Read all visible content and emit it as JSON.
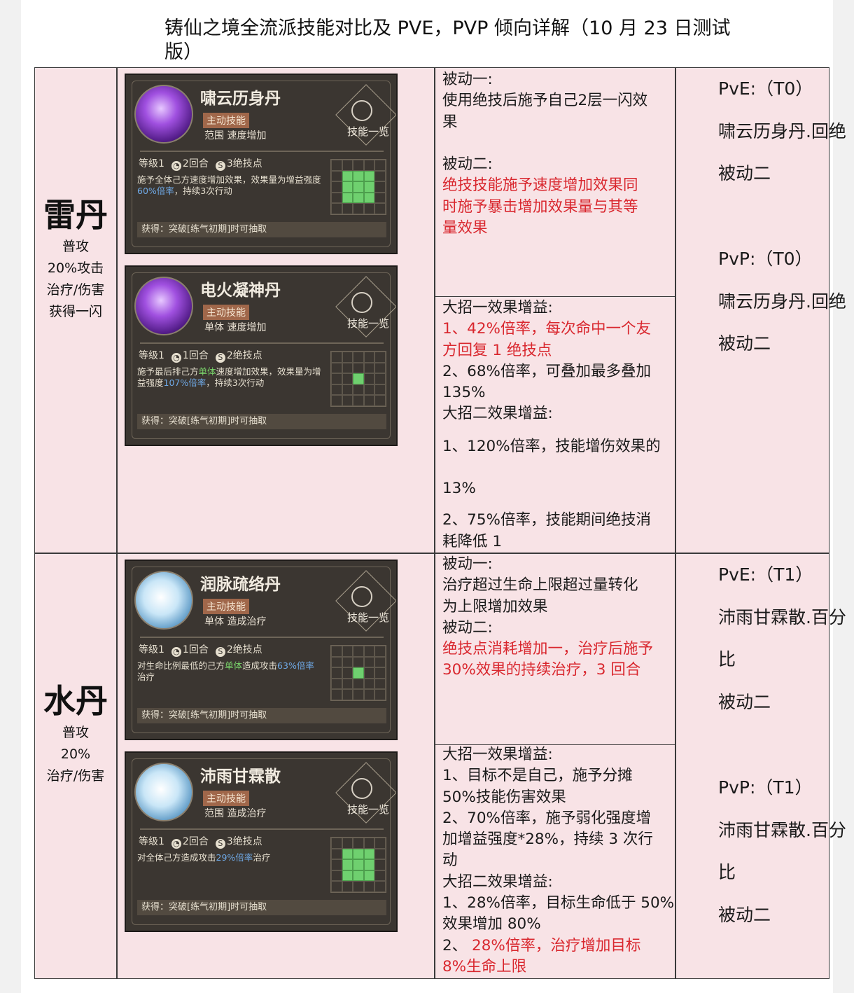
{
  "title_lines": [
    "铸仙之境全流派技能对比及 PVE，PVP 倾向详解（10 月 23 日测试",
    "版）"
  ],
  "rows": [
    {
      "category": {
        "name": "雷丹",
        "notes": [
          "普攻",
          "20%攻击",
          "治疗/伤害",
          "获得一闪"
        ]
      },
      "skills": [
        {
          "name": "啸云历身丹",
          "badge": "主动技能",
          "type": "范围 速度增加",
          "emblem": "技能一览",
          "level": "等级1",
          "turns": "2回合",
          "points": "3绝技点",
          "desc_a": "施予全体己方速度增加效果，效果量为增益强度",
          "desc_b": "60%倍率",
          "desc_c": "，持续3次行动",
          "acquire": "获得：突破[练气初期]时可抽取",
          "area": "3x3",
          "icon": "purple-figure-icon"
        },
        {
          "name": "电火凝神丹",
          "badge": "主动技能",
          "type": "单体 速度增加",
          "emblem": "技能一览",
          "level": "等级1",
          "turns": "1回合",
          "points": "2绝技点",
          "desc_a": "施予最后排己方",
          "desc_g": "单体",
          "desc_a2": "速度增加效果，效果量为增益强度",
          "desc_b": "107%倍率",
          "desc_c": "，持续3次行动",
          "acquire": "获得：突破[练气初期]时可抽取",
          "area": "single",
          "icon": "purple-figure-icon"
        }
      ],
      "passive": {
        "p1_label": "被动一:",
        "p1_lines": [
          "使用绝技后施予自己2层一闪效",
          "果"
        ],
        "p2_label": "被动二:",
        "p2_lines": [
          "绝技技能施予速度增加效果同",
          "时施予暴击增加效果量与其等",
          "量效果"
        ]
      },
      "ult": {
        "u1_label": "大招一效果增益:",
        "u1_lines_red": [
          "1、42%倍率，每次命中一个友",
          "方回复 1 绝技点"
        ],
        "u1_lines": [
          "2、68%倍率，可叠加最多叠加",
          "135%"
        ],
        "u2_label": "大招二效果增益:",
        "u2_a": "1、120%倍率，技能增伤效果的",
        "u2_b": "13%",
        "u2_c": [
          "2、75%倍率，技能期间绝技消",
          "耗降低 1"
        ]
      },
      "tiers": {
        "pve_head": "PvE:（T0）",
        "pve_lines": [
          "啸云历身丹.回绝",
          "被动二"
        ],
        "pvp_head": "PvP:（T0）",
        "pvp_lines": [
          "啸云历身丹.回绝",
          "被动二"
        ]
      }
    },
    {
      "category": {
        "name": "水丹",
        "notes": [
          "普攻",
          "20%",
          "治疗/伤害"
        ]
      },
      "skills": [
        {
          "name": "润脉疏络丹",
          "badge": "主动技能",
          "type": "单体 造成治疗",
          "emblem": "技能一览",
          "level": "等级1",
          "turns": "1回合",
          "points": "2绝技点",
          "desc_a": "对生命比例最低的己方",
          "desc_g": "单体",
          "desc_a2": "造成攻击",
          "desc_b": "63%倍率",
          "desc_c": "治疗",
          "acquire": "获得：突破[练气初期]时可抽取",
          "area": "single",
          "icon": "water-orb-icon"
        },
        {
          "name": "沛雨甘霖散",
          "badge": "主动技能",
          "type": "范围 造成治疗",
          "emblem": "技能一览",
          "level": "等级1",
          "turns": "2回合",
          "points": "3绝技点",
          "desc_a": "对全体己方造成攻击",
          "desc_b": "29%倍率",
          "desc_c": "治疗",
          "acquire": "获得：突破[练气初期]时可抽取",
          "area": "3x3",
          "icon": "water-orb-icon"
        }
      ],
      "passive": {
        "p1_label": "被动一:",
        "p1_lines": [
          "治疗超过生命上限超过量转化",
          "为上限增加效果"
        ],
        "p2_label": "被动二:",
        "p2_lines": [
          "绝技点消耗增加一，治疗后施予",
          "30%效果的持续治疗，3 回合"
        ]
      },
      "ult": {
        "u1_label": "大招一效果增益:",
        "u1_lines": [
          "1、目标不是自己，施予分摊",
          "50%技能伤害效果",
          "2、70%倍率，施予弱化强度增",
          "加增益强度*28%，持续 3 次行",
          "动"
        ],
        "u2_label": "大招二效果增益:",
        "u2_lines": [
          "1、28%倍率，目标生命低于 50%",
          "效果增加 80%"
        ],
        "u2_red_prefix": "2、",
        "u2_red": [
          "28%倍率，治疗增加目标",
          "8%生命上限"
        ]
      },
      "tiers": {
        "pve_head": "PvE:（T1）",
        "pve_lines": [
          "沛雨甘霖散.百分",
          "比",
          "被动二"
        ],
        "pvp_head": "PvP:（T1）",
        "pvp_lines": [
          "沛雨甘霖散.百分",
          "比",
          "被动二"
        ]
      }
    }
  ],
  "colors": {
    "cell_bg": "#f8e3e6",
    "red_text": "#d9272e",
    "card_bg": "#3b3631",
    "highlight_green": "#6fd06f"
  }
}
